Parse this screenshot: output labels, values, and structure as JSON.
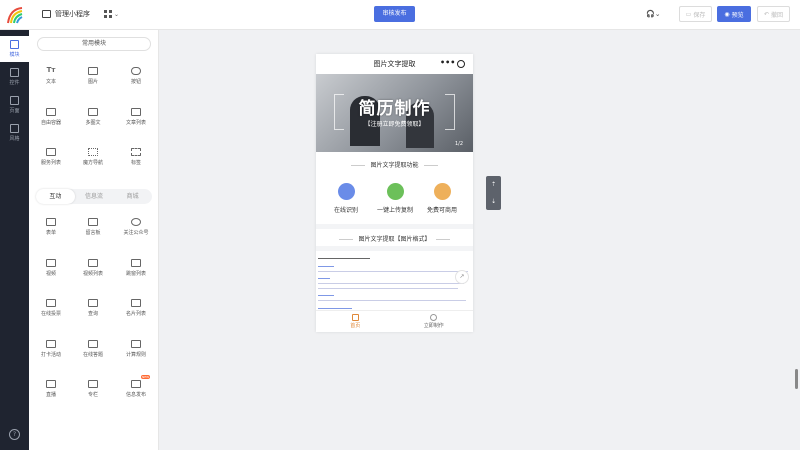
{
  "topbar": {
    "app_name": "管理小程序",
    "publish_label": "审核发布",
    "save_label": "保存",
    "preview_label": "预览",
    "undo_label": "撤回"
  },
  "rail": {
    "items": [
      {
        "label": "模块",
        "icon": "plus-square-icon",
        "active": true
      },
      {
        "label": "控件",
        "icon": "grid-dots-icon"
      },
      {
        "label": "页面",
        "icon": "pages-icon"
      },
      {
        "label": "风格",
        "icon": "palette-icon"
      }
    ],
    "help": "?"
  },
  "palette": {
    "section_label": "常用模块",
    "common": [
      {
        "label": "文本",
        "icon": "Tт"
      },
      {
        "label": "图片",
        "icon": "image-icon"
      },
      {
        "label": "按钮",
        "icon": "button-icon"
      },
      {
        "label": "自由容器",
        "icon": "container-icon"
      },
      {
        "label": "多图文",
        "icon": "multi-article-icon"
      },
      {
        "label": "文章列表",
        "icon": "article-list-icon"
      },
      {
        "label": "服务列表",
        "icon": "service-list-icon"
      },
      {
        "label": "魔方导航",
        "icon": "cube-nav-icon"
      },
      {
        "label": "标签",
        "icon": "tag-icon"
      }
    ],
    "tabs": [
      "互动",
      "信息流",
      "商城"
    ],
    "interactive": [
      {
        "label": "表单",
        "icon": "form-icon"
      },
      {
        "label": "留言板",
        "icon": "message-board-icon"
      },
      {
        "label": "关注公众号",
        "icon": "follow-icon"
      },
      {
        "label": "视频",
        "icon": "video-icon"
      },
      {
        "label": "视频列表",
        "icon": "video-list-icon"
      },
      {
        "label": "跳窗列表",
        "icon": "popup-list-icon"
      },
      {
        "label": "在线投票",
        "icon": "vote-icon"
      },
      {
        "label": "查询",
        "icon": "search-icon"
      },
      {
        "label": "名片列表",
        "icon": "card-list-icon"
      },
      {
        "label": "打卡活动",
        "icon": "checkin-icon"
      },
      {
        "label": "在线答题",
        "icon": "quiz-icon"
      },
      {
        "label": "计算规则",
        "icon": "calc-icon"
      },
      {
        "label": "直播",
        "icon": "live-icon"
      },
      {
        "label": "专栏",
        "icon": "column-icon"
      },
      {
        "label": "信息发布",
        "icon": "info-publish-icon"
      }
    ],
    "new_badge": "NEW"
  },
  "phone": {
    "title": "图片文字提取",
    "banner": {
      "title": "简历制作",
      "subtitle": "【注册立即免费领取】",
      "page": "1/2"
    },
    "feature_title": "图片文字提取功能",
    "features": [
      {
        "label": "在线识别",
        "color": "#6a8ce8"
      },
      {
        "label": "一键上传复制",
        "color": "#6cc05a"
      },
      {
        "label": "免费可商用",
        "color": "#eeb05b"
      }
    ],
    "doc_title": "图片文字提取【图片格式】",
    "nav": [
      {
        "label": "首页",
        "active": true
      },
      {
        "label": "立即制作",
        "active": false
      }
    ]
  },
  "colors": {
    "primary": "#4a6ee0",
    "rail": "#1f2430",
    "accent_orange": "#e0893a"
  }
}
